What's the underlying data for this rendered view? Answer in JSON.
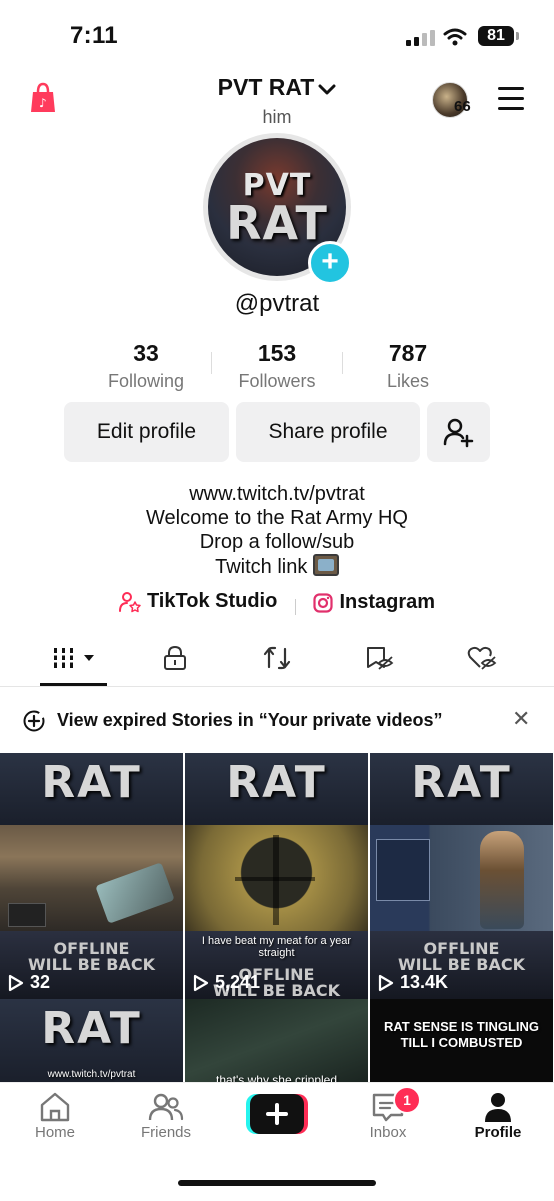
{
  "status_bar": {
    "time": "7:11",
    "battery": "81"
  },
  "header": {
    "username": "PVT RAT",
    "pronouns": "him",
    "notification_count": "66"
  },
  "profile": {
    "avatar_line1": "PVT",
    "avatar_line2": "RAT",
    "handle": "@pvtrat"
  },
  "stats": [
    {
      "value": "33",
      "label": "Following"
    },
    {
      "value": "153",
      "label": "Followers"
    },
    {
      "value": "787",
      "label": "Likes"
    }
  ],
  "actions": {
    "edit": "Edit profile",
    "share": "Share profile"
  },
  "bio": {
    "line1": "www.twitch.tv/pvtrat",
    "line2": "Welcome to the Rat Army HQ",
    "line3": "Drop a follow/sub",
    "line4": "Twitch link"
  },
  "links": {
    "studio": "TikTok Studio",
    "instagram": "Instagram"
  },
  "banner": {
    "text": "View expired Stories in “Your private videos”"
  },
  "videos": [
    {
      "views": "32",
      "thumb_title": "RAT",
      "offline1": "OFFLINE",
      "offline2": "WILL BE BACK",
      "caption": ""
    },
    {
      "views": "5,241",
      "thumb_title": "RAT",
      "offline1": "OFFLINE",
      "offline2": "WILL BE BACK",
      "caption": "I have beat my meat for a year straight"
    },
    {
      "views": "13.4K",
      "thumb_title": "RAT",
      "offline1": "OFFLINE",
      "offline2": "WILL BE BACK",
      "caption": ""
    }
  ],
  "row2": [
    {
      "thumb_title": "RAT",
      "caption": "www.twitch.tv/pvtrat"
    },
    {
      "caption": "that's why she crippled"
    },
    {
      "caption": "RAT SENSE IS TINGLING TILL I COMBUSTED"
    }
  ],
  "nav": {
    "home": "Home",
    "friends": "Friends",
    "inbox": "Inbox",
    "inbox_badge": "1",
    "profile": "Profile"
  },
  "colors": {
    "accent": "#22c4e0",
    "badge": "#ff2d55",
    "tiktok_pink": "#fe2c55",
    "tiktok_cyan": "#25f4ee"
  }
}
